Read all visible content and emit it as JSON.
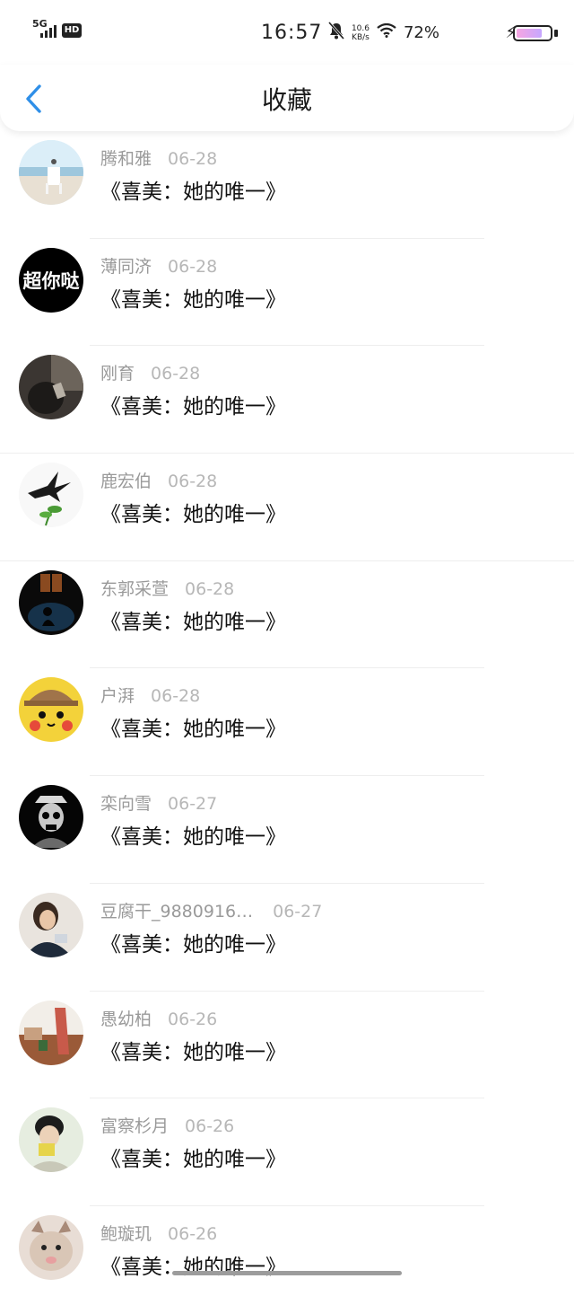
{
  "status_bar": {
    "network": "5G",
    "hd": "HD",
    "time": "16:57",
    "speed_value": "10.6",
    "speed_unit": "KB/s",
    "battery": "72%"
  },
  "header": {
    "title": "收藏",
    "back_icon": "chevron-left-icon"
  },
  "items": [
    {
      "name": "腾和雅",
      "date": "06-28",
      "title": "《喜美：她的唯一》",
      "avatar": "beach-chair"
    },
    {
      "name": "薄同济",
      "date": "06-28",
      "title": "《喜美：她的唯一》",
      "avatar": "text-logo"
    },
    {
      "name": "刚育",
      "date": "06-28",
      "title": "《喜美：她的唯一》",
      "avatar": "dark-photo"
    },
    {
      "name": "鹿宏伯",
      "date": "06-28",
      "title": "《喜美：她的唯一》",
      "avatar": "swallow"
    },
    {
      "name": "东郭采萱",
      "date": "06-28",
      "title": "《喜美：她的唯一》",
      "avatar": "dark-window"
    },
    {
      "name": "户湃",
      "date": "06-28",
      "title": "《喜美：她的唯一》",
      "avatar": "pikachu"
    },
    {
      "name": "栾向雪",
      "date": "06-27",
      "title": "《喜美：她的唯一》",
      "avatar": "skull"
    },
    {
      "name": "豆腐干_9880916…",
      "date": "06-27",
      "title": "《喜美：她的唯一》",
      "avatar": "girl"
    },
    {
      "name": "愚幼柏",
      "date": "06-26",
      "title": "《喜美：她的唯一》",
      "avatar": "town"
    },
    {
      "name": "富察杉月",
      "date": "06-26",
      "title": "《喜美：她的唯一》",
      "avatar": "boy"
    },
    {
      "name": "鲍璇玑",
      "date": "06-26",
      "title": "《喜美：她的唯一》",
      "avatar": "cat"
    }
  ],
  "avatar_logo_text": "超你哒"
}
